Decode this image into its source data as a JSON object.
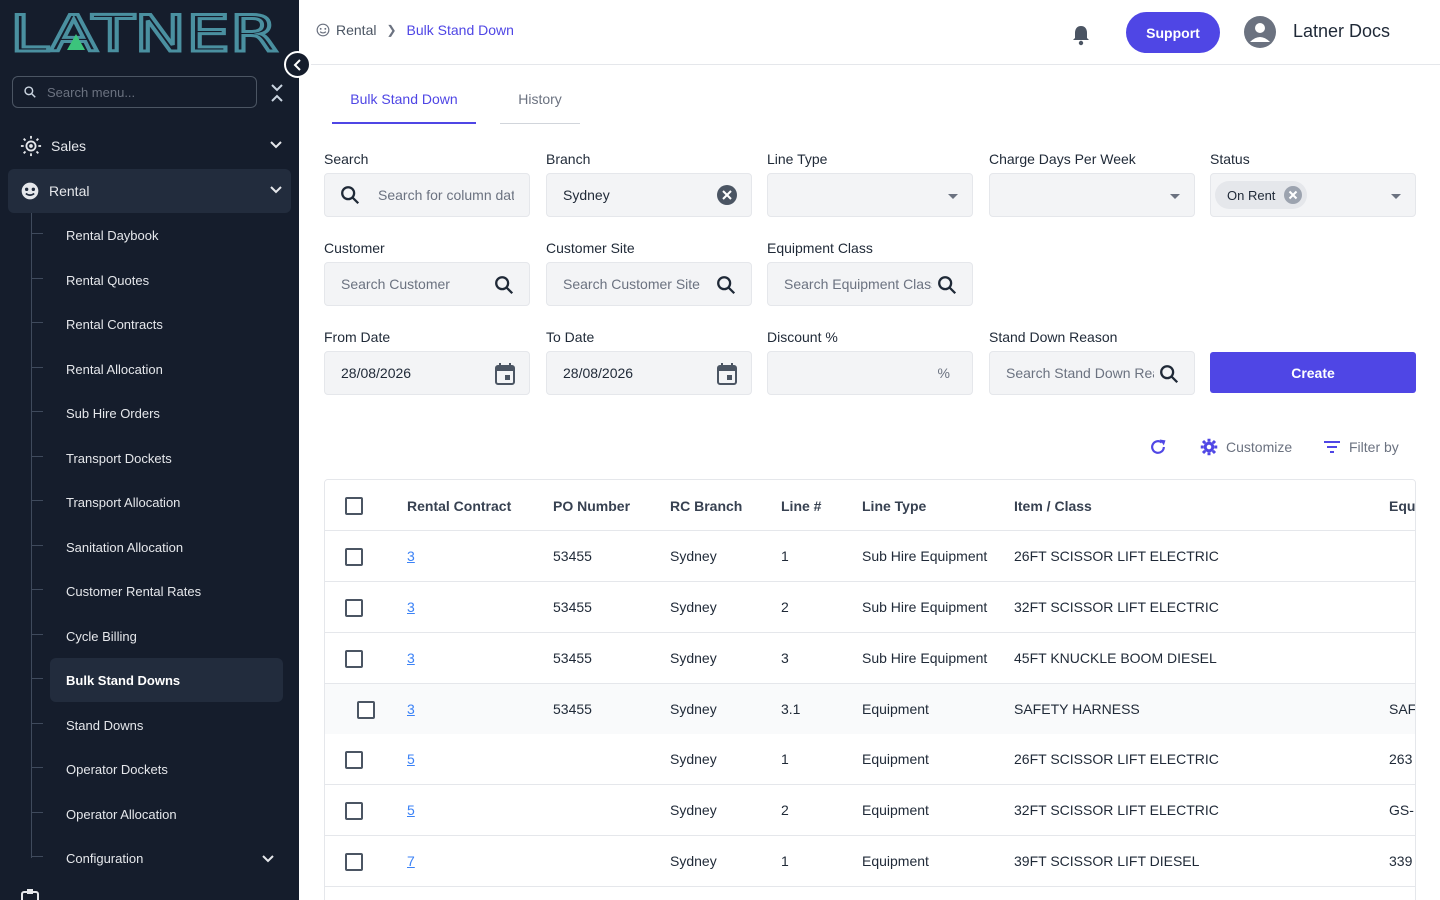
{
  "sidebar": {
    "logo_text": "LATNER",
    "search_placeholder": "Search menu...",
    "sales_label": "Sales",
    "rental_label": "Rental",
    "items": [
      {
        "label": "Rental Daybook"
      },
      {
        "label": "Rental Quotes"
      },
      {
        "label": "Rental Contracts"
      },
      {
        "label": "Rental Allocation"
      },
      {
        "label": "Sub Hire Orders"
      },
      {
        "label": "Transport Dockets"
      },
      {
        "label": "Transport Allocation"
      },
      {
        "label": "Sanitation Allocation"
      },
      {
        "label": "Customer Rental Rates"
      },
      {
        "label": "Cycle Billing"
      },
      {
        "label": "Bulk Stand Downs"
      },
      {
        "label": "Stand Downs"
      },
      {
        "label": "Operator Dockets"
      },
      {
        "label": "Operator Allocation"
      },
      {
        "label": "Configuration"
      }
    ],
    "active_item": "Bulk Stand Downs"
  },
  "header": {
    "breadcrumb_root": "Rental",
    "breadcrumb_current": "Bulk Stand Down",
    "support_label": "Support",
    "user_name": "Latner Docs"
  },
  "tabs": [
    {
      "label": "Bulk Stand Down",
      "active": true
    },
    {
      "label": "History",
      "active": false
    }
  ],
  "form": {
    "search": {
      "label": "Search",
      "placeholder": "Search for column data"
    },
    "branch": {
      "label": "Branch",
      "value": "Sydney"
    },
    "line_type": {
      "label": "Line Type",
      "value": ""
    },
    "charge_days": {
      "label": "Charge Days Per Week",
      "value": ""
    },
    "status": {
      "label": "Status",
      "chip": "On Rent"
    },
    "customer": {
      "label": "Customer",
      "placeholder": "Search Customer"
    },
    "customer_site": {
      "label": "Customer Site",
      "placeholder": "Search Customer Site"
    },
    "equipment_class": {
      "label": "Equipment Class",
      "placeholder": "Search Equipment Class"
    },
    "from_date": {
      "label": "From Date",
      "value": "28/08/2026"
    },
    "to_date": {
      "label": "To Date",
      "value": "28/08/2026"
    },
    "discount": {
      "label": "Discount %",
      "suffix": "%",
      "value": ""
    },
    "stand_down_reason": {
      "label": "Stand Down Reason",
      "placeholder": "Search Stand Down Reason"
    },
    "create_label": "Create"
  },
  "toolbar": {
    "customize_label": "Customize",
    "filter_label": "Filter by"
  },
  "table": {
    "columns": [
      "Rental Contract",
      "PO Number",
      "RC Branch",
      "Line #",
      "Line Type",
      "Item / Class",
      "Equ"
    ],
    "rows": [
      {
        "contract": "3",
        "po": "53455",
        "branch": "Sydney",
        "line": "1",
        "type": "Sub Hire Equipment",
        "item": "26FT SCISSOR LIFT ELECTRIC",
        "equ": ""
      },
      {
        "contract": "3",
        "po": "53455",
        "branch": "Sydney",
        "line": "2",
        "type": "Sub Hire Equipment",
        "item": "32FT SCISSOR LIFT ELECTRIC",
        "equ": ""
      },
      {
        "contract": "3",
        "po": "53455",
        "branch": "Sydney",
        "line": "3",
        "type": "Sub Hire Equipment",
        "item": "45FT KNUCKLE BOOM DIESEL",
        "equ": ""
      },
      {
        "contract": "3",
        "po": "53455",
        "branch": "Sydney",
        "line": "3.1",
        "type": "Equipment",
        "item": "SAFETY HARNESS",
        "equ": "SAF"
      },
      {
        "contract": "5",
        "po": "",
        "branch": "Sydney",
        "line": "1",
        "type": "Equipment",
        "item": "26FT SCISSOR LIFT ELECTRIC",
        "equ": "263"
      },
      {
        "contract": "5",
        "po": "",
        "branch": "Sydney",
        "line": "2",
        "type": "Equipment",
        "item": "32FT SCISSOR LIFT ELECTRIC",
        "equ": "GS-"
      },
      {
        "contract": "7",
        "po": "",
        "branch": "Sydney",
        "line": "1",
        "type": "Equipment",
        "item": "39FT SCISSOR LIFT DIESEL",
        "equ": "339"
      }
    ]
  },
  "colors": {
    "accent": "#4f46e5",
    "sidebar_bg": "#151d2c",
    "logo_teal": "#4a90a0",
    "logo_green": "#3cc47c",
    "link": "#3b82f6"
  }
}
